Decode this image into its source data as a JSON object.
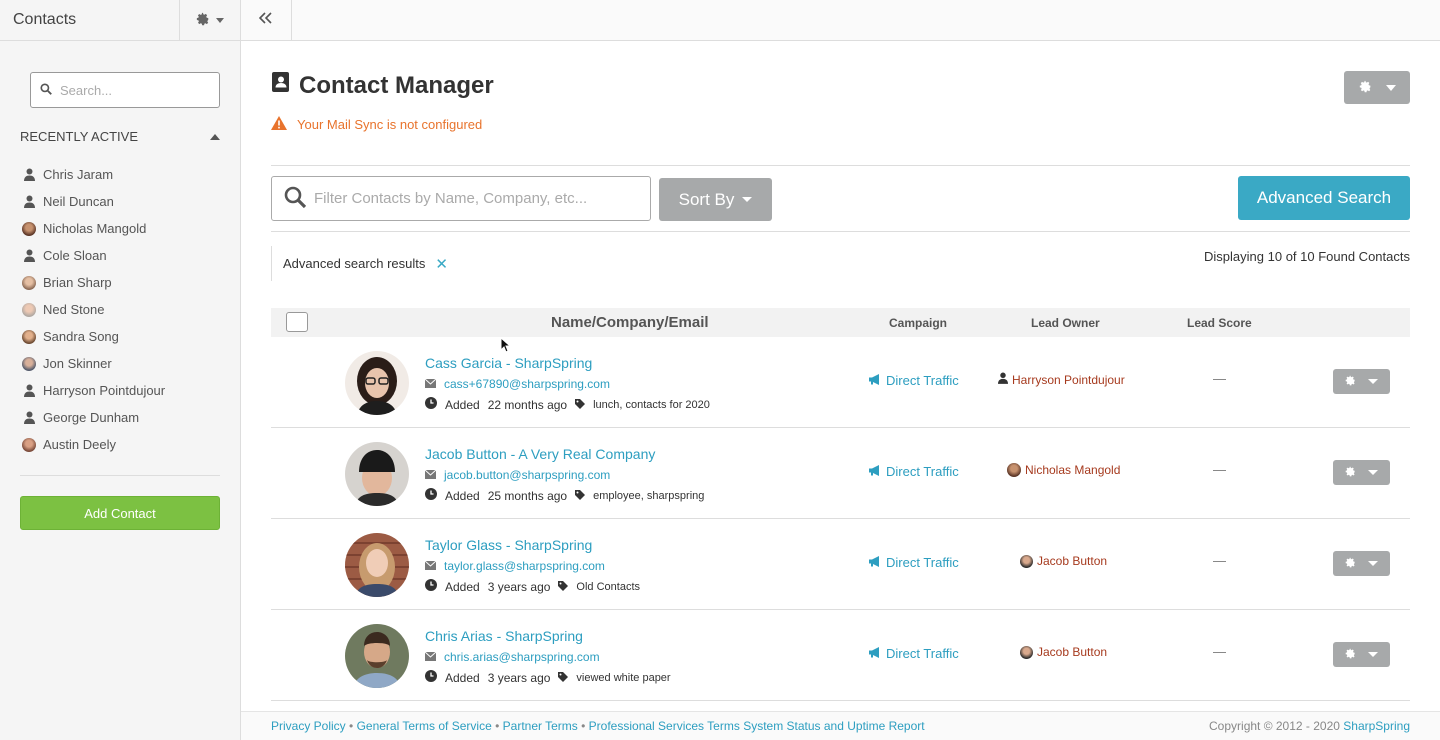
{
  "sidebar": {
    "title": "Contacts",
    "search_placeholder": "Search...",
    "recent_header": "RECENTLY ACTIVE",
    "recent": [
      {
        "name": "Chris Jaram",
        "icon": "person-icon"
      },
      {
        "name": "Neil Duncan",
        "icon": "person-icon"
      },
      {
        "name": "Nicholas Mangold",
        "icon": "avatar"
      },
      {
        "name": "Cole Sloan",
        "icon": "person-icon"
      },
      {
        "name": "Brian Sharp",
        "icon": "avatar"
      },
      {
        "name": "Ned Stone",
        "icon": "avatar"
      },
      {
        "name": "Sandra Song",
        "icon": "avatar"
      },
      {
        "name": "Jon Skinner",
        "icon": "avatar"
      },
      {
        "name": "Harryson Pointdujour",
        "icon": "person-icon"
      },
      {
        "name": "George Dunham",
        "icon": "person-icon"
      },
      {
        "name": "Austin Deely",
        "icon": "avatar"
      }
    ],
    "add_contact": "Add Contact"
  },
  "page": {
    "title": "Contact Manager",
    "warning": "Your Mail Sync is not configured",
    "filter_placeholder": "Filter Contacts by Name, Company, etc...",
    "sort_by": "Sort By",
    "advanced_search": "Advanced Search",
    "advanced_results": "Advanced search results",
    "displaying": "Displaying 10 of 10 Found Contacts"
  },
  "table": {
    "headers": {
      "name": "Name/Company/Email",
      "campaign": "Campaign",
      "owner": "Lead Owner",
      "score": "Lead Score"
    },
    "rows": [
      {
        "name": "Cass Garcia - SharpSpring",
        "email": "cass+67890@sharpspring.com",
        "added_prefix": "Added",
        "added": "22 months ago",
        "tags": "lunch, contacts for 2020",
        "campaign": "Direct Traffic",
        "owner": "Harryson Pointdujour",
        "score": "—"
      },
      {
        "name": "Jacob Button - A Very Real Company",
        "email": "jacob.button@sharpspring.com",
        "added_prefix": "Added",
        "added": "25 months ago",
        "tags": "employee, sharpspring",
        "campaign": "Direct Traffic",
        "owner": "Nicholas Mangold",
        "score": "—"
      },
      {
        "name": "Taylor Glass - SharpSpring",
        "email": "taylor.glass@sharpspring.com",
        "added_prefix": "Added",
        "added": "3 years ago",
        "tags": "Old Contacts",
        "campaign": "Direct Traffic",
        "owner": "Jacob Button",
        "score": "—"
      },
      {
        "name": "Chris Arias - SharpSpring",
        "email": "chris.arias@sharpspring.com",
        "added_prefix": "Added",
        "added": "3 years ago",
        "tags": "viewed white paper",
        "campaign": "Direct Traffic",
        "owner": "Jacob Button",
        "score": "—"
      }
    ]
  },
  "footer": {
    "privacy": "Privacy Policy",
    "terms": "General Terms of Service",
    "partner": "Partner Terms",
    "professional": "Professional Services Terms",
    "status": "System Status and Uptime Report",
    "copyright": "Copyright © 2012 - 2020",
    "brand": "SharpSpring",
    "bullet": "•"
  },
  "colors": {
    "accent": "#3aa9c5",
    "link": "#2d9ec0",
    "warning": "#e8732c",
    "owner": "#a63a1e",
    "add": "#7cc142",
    "gray_button": "#a7a9aa"
  }
}
